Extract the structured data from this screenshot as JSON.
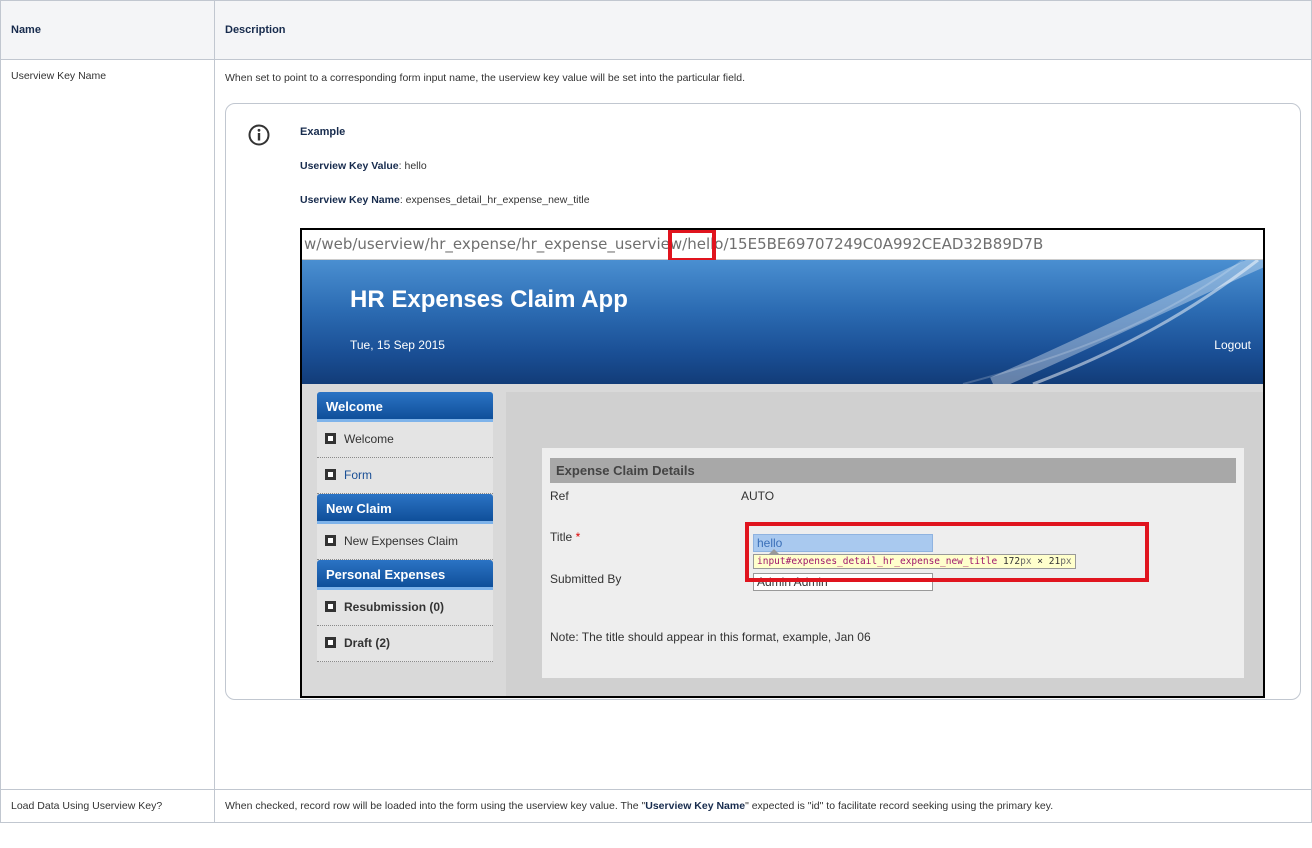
{
  "table": {
    "headers": {
      "name": "Name",
      "description": "Description"
    },
    "rows": [
      {
        "name": "Userview Key Name",
        "description": "When set to point to a corresponding form input name, the userview key value will be set into the particular field."
      },
      {
        "name": "Load Data Using Userview Key?",
        "description_pre": "When checked, record row will be loaded into the form using the userview key value. The \"",
        "description_bold": "Userview Key Name",
        "description_post": "\" expected is \"id\" to facilitate record seeking using the primary key."
      }
    ]
  },
  "info_panel": {
    "icon": "info-icon",
    "title": "Example",
    "key_value_label": "Userview Key Value",
    "key_value": ": hello",
    "key_name_label": "Userview Key Name",
    "key_name": ": expenses_detail_hr_expense_new_title"
  },
  "screenshot": {
    "url": "w/web/userview/hr_expense/hr_expense_userview/hello/15E5BE69707249C0A992CEAD32B89D7B",
    "app_title": "HR Expenses Claim App",
    "date": "Tue, 15 Sep 2015",
    "logout": "Logout",
    "sidebar": [
      {
        "type": "header",
        "label": "Welcome"
      },
      {
        "type": "item",
        "label": "Welcome",
        "style": "plain"
      },
      {
        "type": "item",
        "label": "Form",
        "style": "link"
      },
      {
        "type": "header",
        "label": "New Claim"
      },
      {
        "type": "item",
        "label": "New Expenses Claim",
        "style": "plain"
      },
      {
        "type": "header",
        "label": "Personal Expenses"
      },
      {
        "type": "item",
        "label": "Resubmission (0)",
        "style": "bold"
      },
      {
        "type": "item",
        "label": "Draft (2)",
        "style": "bold"
      }
    ],
    "form": {
      "header": "Expense Claim Details",
      "ref_label": "Ref",
      "ref_value": "AUTO",
      "title_label": "Title",
      "required_mark": "*",
      "title_value": "hello",
      "submitted_label": "Submitted By",
      "submitted_value": "Admin Admin",
      "note": "Note: The title should appear in this format, example, Jan 06"
    },
    "tooltip": {
      "selector": "input#expenses_detail_hr_expense_new_title",
      "w": "172",
      "unit1": "px",
      "times": " × ",
      "h": "21",
      "unit2": "px"
    },
    "colors": {
      "highlight": "#e0141e",
      "banner": "#1a4f95"
    }
  }
}
